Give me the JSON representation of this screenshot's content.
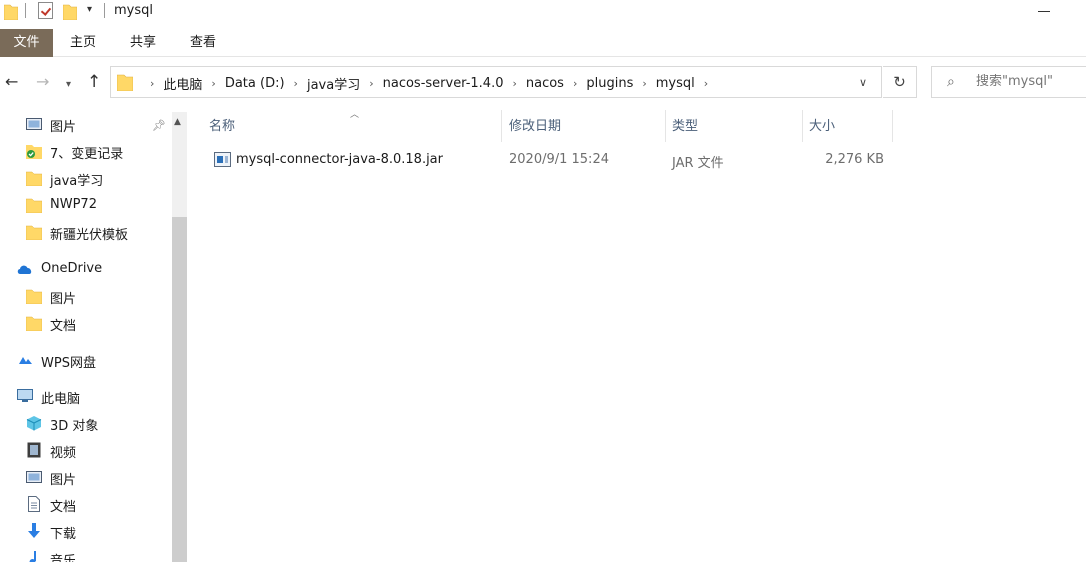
{
  "window": {
    "title": "mysql"
  },
  "ribbon": {
    "tabs": [
      "文件",
      "主页",
      "共享",
      "查看"
    ]
  },
  "address": {
    "crumbs": [
      "此电脑",
      "Data (D:)",
      "java学习",
      "nacos-server-1.4.0",
      "nacos",
      "plugins",
      "mysql"
    ]
  },
  "search": {
    "placeholder": "搜索\"mysql\""
  },
  "sidebar": {
    "quick_access": [
      "图片",
      "7、变更记录",
      "java学习",
      "NWP72",
      "新疆光伏模板"
    ],
    "onedrive": {
      "label": "OneDrive",
      "items": [
        "图片",
        "文档"
      ]
    },
    "wps": "WPS网盘",
    "this_pc": {
      "label": "此电脑",
      "items": [
        "3D 对象",
        "视频",
        "图片",
        "文档",
        "下载",
        "音乐"
      ]
    }
  },
  "columns": {
    "name": "名称",
    "date": "修改日期",
    "type": "类型",
    "size": "大小"
  },
  "files": [
    {
      "name": "mysql-connector-java-8.0.18.jar",
      "date": "2020/9/1 15:24",
      "type": "JAR 文件",
      "size": "2,276 KB"
    }
  ],
  "colors": {
    "file_tab": "#7a6b59",
    "header_text": "#4c607a",
    "folder_yellow": "#ffd867"
  }
}
